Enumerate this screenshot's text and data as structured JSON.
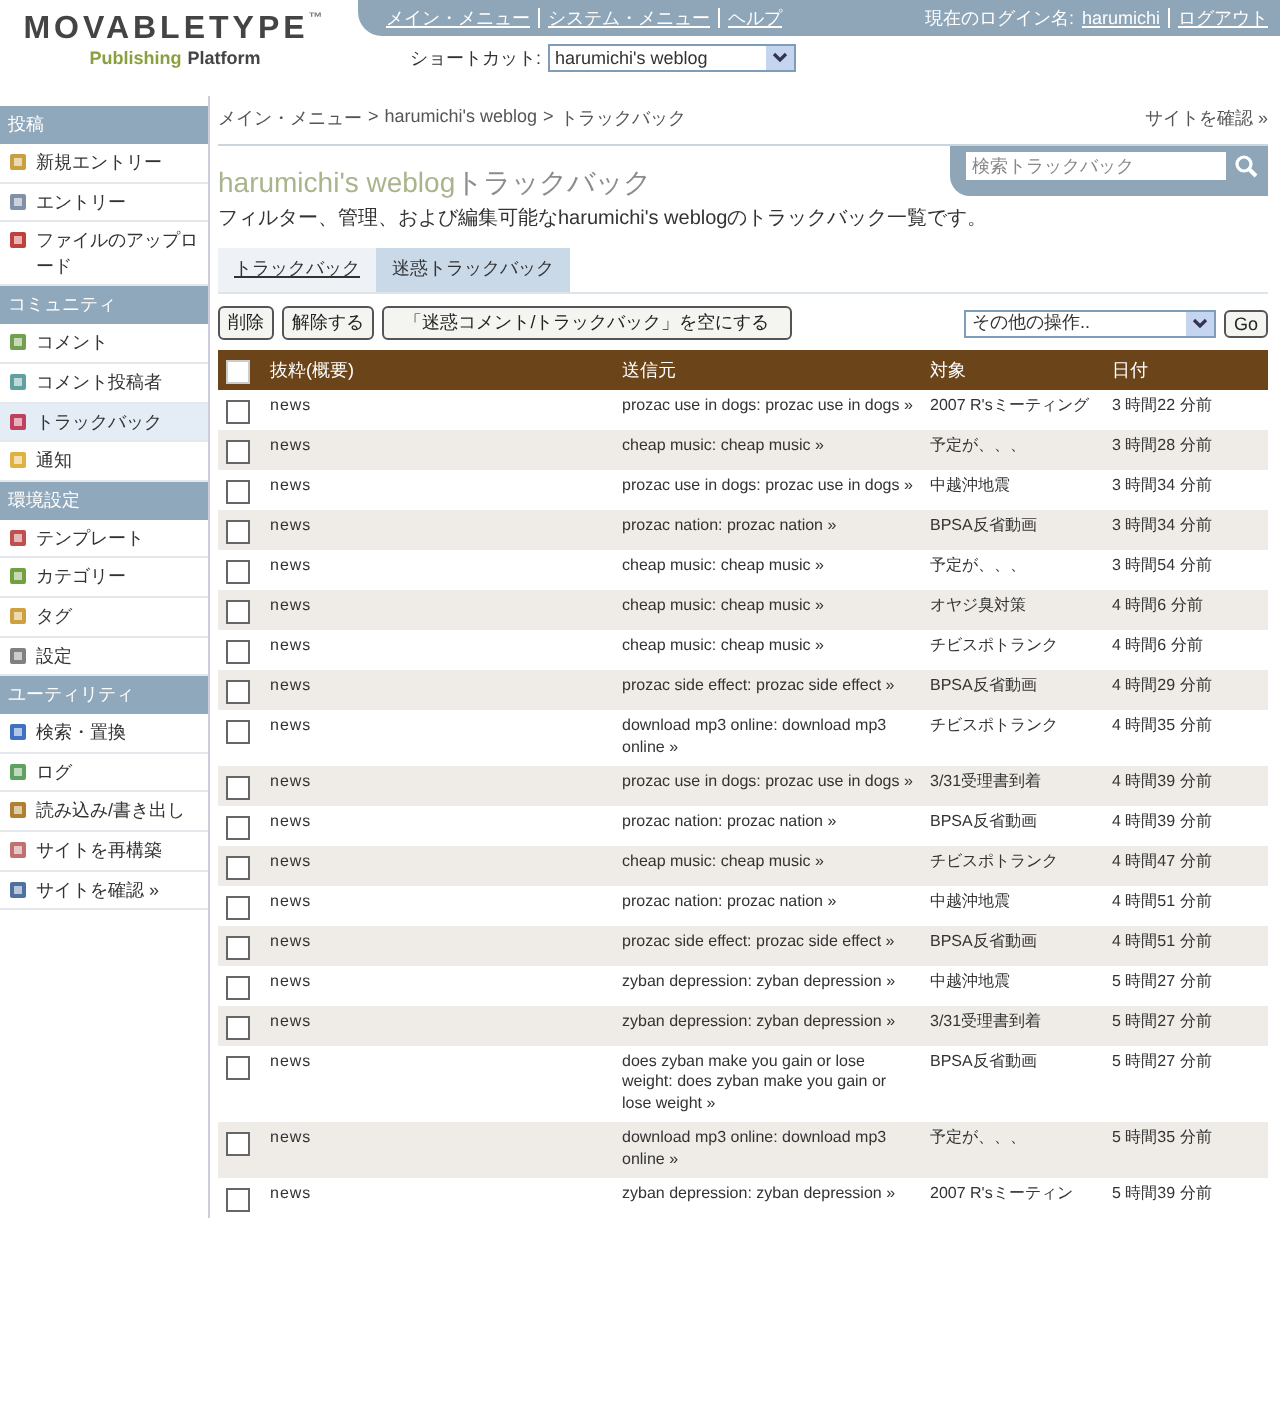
{
  "header": {
    "logo": {
      "wordmark": "MOVABLETYPE",
      "tm": "™",
      "tagline_1": "Publishing",
      "tagline_2": "Platform"
    },
    "nav_links": [
      "メイン・メニュー",
      "システム・メニュー",
      "ヘルプ"
    ],
    "user": {
      "label": "現在のログイン名:",
      "name": "harumichi",
      "logout": "ログアウト"
    },
    "shortcut": {
      "label": "ショートカット:",
      "value": "harumichi's weblog"
    }
  },
  "sidebar": {
    "sections": [
      {
        "title": "投稿",
        "items": [
          {
            "label": "新規エントリー",
            "selected": false
          },
          {
            "label": "エントリー",
            "selected": false
          },
          {
            "label": "ファイルのアップロード",
            "selected": false
          }
        ]
      },
      {
        "title": "コミュニティ",
        "items": [
          {
            "label": "コメント",
            "selected": false
          },
          {
            "label": "コメント投稿者",
            "selected": false
          },
          {
            "label": "トラックバック",
            "selected": true
          },
          {
            "label": "通知",
            "selected": false
          }
        ]
      },
      {
        "title": "環境設定",
        "items": [
          {
            "label": "テンプレート",
            "selected": false
          },
          {
            "label": "カテゴリー",
            "selected": false
          },
          {
            "label": "タグ",
            "selected": false
          },
          {
            "label": "設定",
            "selected": false
          }
        ]
      },
      {
        "title": "ユーティリティ",
        "items": [
          {
            "label": "検索・置換",
            "selected": false
          },
          {
            "label": "ログ",
            "selected": false
          },
          {
            "label": "読み込み/書き出し",
            "selected": false
          },
          {
            "label": "サイトを再構築",
            "selected": false
          },
          {
            "label": "サイトを確認 »",
            "selected": false
          }
        ]
      }
    ]
  },
  "breadcrumb": {
    "items": [
      "メイン・メニュー",
      "harumichi's weblog",
      "トラックバック"
    ],
    "separator": ">"
  },
  "view_site": "サイトを確認 »",
  "search": {
    "placeholder": "検索トラックバック"
  },
  "title": {
    "blog": "harumichi's weblog",
    "page": "トラックバック"
  },
  "description": "フィルター、管理、および編集可能なharumichi's weblogのトラックバック一覧です。",
  "tabs": [
    {
      "label": "トラックバック",
      "selected": false
    },
    {
      "label": "迷惑トラックバック",
      "selected": true
    }
  ],
  "buttons": [
    "削除",
    "解除する",
    "「迷惑コメント/トラックバック」を空にする"
  ],
  "actions": {
    "value": "その他の操作..",
    "go": "Go"
  },
  "table": {
    "all_checked": false,
    "columns": [
      "抜粋(概要)",
      "送信元",
      "対象",
      "日付"
    ],
    "rows": [
      {
        "checked": false,
        "excerpt": "news",
        "source": "prozac use in dogs: prozac use in dogs »",
        "target": "2007 R'sミーティング",
        "date": "3 時間22 分前"
      },
      {
        "checked": false,
        "excerpt": "news",
        "source": "cheap music: cheap music »",
        "target": "予定が、、、",
        "date": "3 時間28 分前"
      },
      {
        "checked": false,
        "excerpt": "news",
        "source": "prozac use in dogs: prozac use in dogs »",
        "target": "中越沖地震",
        "date": "3 時間34 分前"
      },
      {
        "checked": false,
        "excerpt": "news",
        "source": "prozac nation: prozac nation »",
        "target": "BPSA反省動画",
        "date": "3 時間34 分前"
      },
      {
        "checked": false,
        "excerpt": "news",
        "source": "cheap music: cheap music »",
        "target": "予定が、、、",
        "date": "3 時間54 分前"
      },
      {
        "checked": false,
        "excerpt": "news",
        "source": "cheap music: cheap music »",
        "target": "オヤジ臭対策",
        "date": "4 時間6 分前"
      },
      {
        "checked": false,
        "excerpt": "news",
        "source": "cheap music: cheap music »",
        "target": "チビスポトランク",
        "date": "4 時間6 分前"
      },
      {
        "checked": false,
        "excerpt": "news",
        "source": "prozac side effect: prozac side effect »",
        "target": "BPSA反省動画",
        "date": "4 時間29 分前"
      },
      {
        "checked": false,
        "excerpt": "news",
        "source": "download mp3 online: download mp3 online »",
        "target": "チビスポトランク",
        "date": "4 時間35 分前"
      },
      {
        "checked": false,
        "excerpt": "news",
        "source": "prozac use in dogs: prozac use in dogs »",
        "target": "3/31受理書到着",
        "date": "4 時間39 分前"
      },
      {
        "checked": false,
        "excerpt": "news",
        "source": "prozac nation: prozac nation »",
        "target": "BPSA反省動画",
        "date": "4 時間39 分前"
      },
      {
        "checked": false,
        "excerpt": "news",
        "source": "cheap music: cheap music »",
        "target": "チビスポトランク",
        "date": "4 時間47 分前"
      },
      {
        "checked": false,
        "excerpt": "news",
        "source": "prozac nation: prozac nation »",
        "target": "中越沖地震",
        "date": "4 時間51 分前"
      },
      {
        "checked": false,
        "excerpt": "news",
        "source": "prozac side effect: prozac side effect »",
        "target": "BPSA反省動画",
        "date": "4 時間51 分前"
      },
      {
        "checked": false,
        "excerpt": "news",
        "source": "zyban depression: zyban depression »",
        "target": "中越沖地震",
        "date": "5 時間27 分前"
      },
      {
        "checked": false,
        "excerpt": "news",
        "source": "zyban depression: zyban depression »",
        "target": "3/31受理書到着",
        "date": "5 時間27 分前"
      },
      {
        "checked": false,
        "excerpt": "news",
        "source": "does zyban make you gain or lose weight: does zyban make you gain or lose weight »",
        "target": "BPSA反省動画",
        "date": "5 時間27 分前"
      },
      {
        "checked": false,
        "excerpt": "news",
        "source": "download mp3 online: download mp3 online »",
        "target": "予定が、、、",
        "date": "5 時間35 分前"
      },
      {
        "checked": false,
        "excerpt": "news",
        "source": "zyban depression: zyban depression »",
        "target": "2007 R'sミーティン",
        "date": "5 時間39 分前"
      }
    ]
  }
}
